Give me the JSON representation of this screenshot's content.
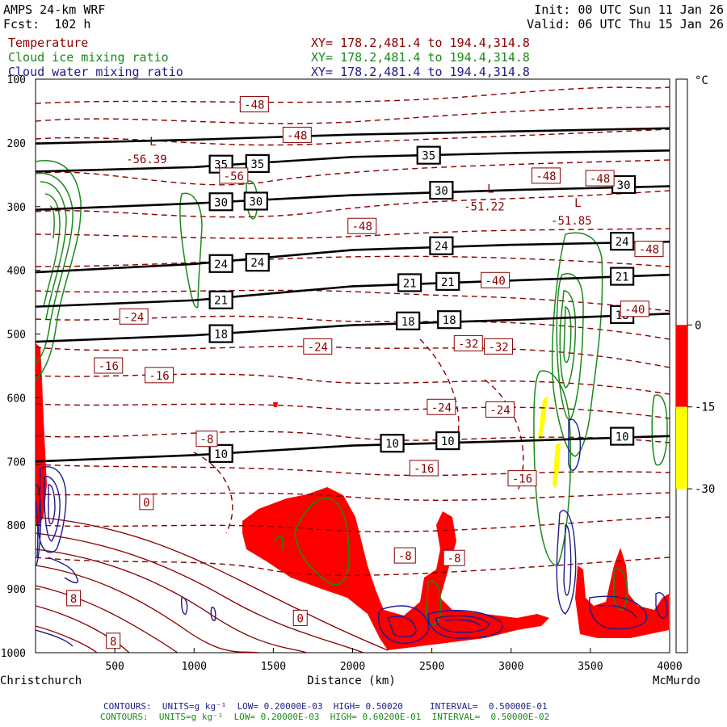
{
  "header": {
    "model": "AMPS 24-km WRF",
    "init_label": "Init:",
    "init_value": "00 UTC Sun 11 Jan 26",
    "fcst_label": "Fcst:",
    "fcst_value": "102 h",
    "valid_label": "Valid:",
    "valid_value": "06 UTC Thu 15 Jan 26",
    "fields": [
      {
        "name": "Temperature",
        "xy": "XY= 178.2,481.4 to 194.4,314.8"
      },
      {
        "name": "Cloud ice mixing ratio",
        "xy": "XY= 178.2,481.4 to 194.4,314.8"
      },
      {
        "name": "Cloud water mixing ratio",
        "xy": "XY= 178.2,481.4 to 194.4,314.8"
      }
    ]
  },
  "colors": {
    "temperature": "#8b0000",
    "cloud_ice": "#1a8a1a",
    "cloud_water": "#1c1c8c",
    "fill_red": "#ff0000",
    "fill_yellow": "#ffff00",
    "theta_lines": "#000000"
  },
  "chart_data": {
    "type": "line",
    "xlabel": "Distance (km)",
    "x_end_labels": {
      "left": "Christchurch",
      "right": "McMurdo"
    },
    "xlim": [
      0,
      4000
    ],
    "ylim": [
      1000,
      100
    ],
    "x_ticks": [
      500,
      1000,
      1500,
      2000,
      2500,
      3000,
      3500,
      4000
    ],
    "y_ticks": [
      100,
      200,
      300,
      400,
      500,
      600,
      700,
      800,
      900,
      1000
    ],
    "theta_lines": [
      {
        "label": "10",
        "points": [
          [
            0,
            700
          ],
          [
            1000,
            690
          ],
          [
            2000,
            675
          ],
          [
            3000,
            668
          ],
          [
            4000,
            660
          ]
        ],
        "label_at": [
          [
            1170,
            688
          ],
          [
            2250,
            672
          ],
          [
            2600,
            668
          ],
          [
            3700,
            661
          ]
        ]
      },
      {
        "label": "18",
        "points": [
          [
            0,
            512
          ],
          [
            1000,
            502
          ],
          [
            2000,
            486
          ],
          [
            3000,
            478
          ],
          [
            4000,
            468
          ]
        ],
        "label_at": [
          [
            1170,
            500
          ],
          [
            2350,
            480
          ],
          [
            2610,
            478
          ],
          [
            3700,
            470
          ]
        ]
      },
      {
        "label": "21",
        "points": [
          [
            0,
            457
          ],
          [
            1000,
            447
          ],
          [
            2000,
            425
          ],
          [
            3000,
            416
          ],
          [
            4000,
            407
          ]
        ],
        "label_at": [
          [
            1170,
            447
          ],
          [
            2360,
            420
          ],
          [
            2600,
            418
          ],
          [
            3700,
            410
          ]
        ]
      },
      {
        "label": "24",
        "points": [
          [
            0,
            403
          ],
          [
            1000,
            390
          ],
          [
            2000,
            368
          ],
          [
            3000,
            360
          ],
          [
            4000,
            355
          ]
        ],
        "label_at": [
          [
            1170,
            390
          ],
          [
            1400,
            388
          ],
          [
            2560,
            362
          ],
          [
            3700,
            355
          ]
        ]
      },
      {
        "label": "30",
        "points": [
          [
            0,
            305
          ],
          [
            1000,
            295
          ],
          [
            2000,
            282
          ],
          [
            3000,
            274
          ],
          [
            4000,
            268
          ]
        ],
        "label_at": [
          [
            1170,
            293
          ],
          [
            1390,
            292
          ],
          [
            2560,
            275
          ],
          [
            3710,
            266
          ]
        ]
      },
      {
        "label": "35",
        "points": [
          [
            0,
            245
          ],
          [
            1000,
            238
          ],
          [
            2000,
            222
          ],
          [
            3000,
            216
          ],
          [
            4000,
            212
          ]
        ],
        "label_at": [
          [
            1170,
            234
          ],
          [
            1400,
            233
          ],
          [
            2480,
            220
          ]
        ]
      },
      {
        "label": "",
        "points": [
          [
            0,
            201
          ],
          [
            1000,
            195
          ],
          [
            2000,
            187
          ],
          [
            3000,
            182
          ],
          [
            4000,
            177
          ]
        ],
        "label_at": []
      }
    ],
    "temperature_labels": [
      {
        "t": "-48",
        "x": 1380,
        "y": 140
      },
      {
        "t": "-48",
        "x": 1650,
        "y": 188
      },
      {
        "t": "-56",
        "x": 1250,
        "y": 252
      },
      {
        "t": "-48",
        "x": 3220,
        "y": 252
      },
      {
        "t": "-48",
        "x": 3560,
        "y": 256
      },
      {
        "t": "-48",
        "x": 2060,
        "y": 331
      },
      {
        "t": "-48",
        "x": 3870,
        "y": 367
      },
      {
        "t": "-40",
        "x": 2900,
        "y": 416
      },
      {
        "t": "-40",
        "x": 3780,
        "y": 461
      },
      {
        "t": "-24",
        "x": 620,
        "y": 473
      },
      {
        "t": "-32",
        "x": 2730,
        "y": 515
      },
      {
        "t": "-32",
        "x": 2920,
        "y": 520
      },
      {
        "t": "-24",
        "x": 1780,
        "y": 520
      },
      {
        "t": "-16",
        "x": 460,
        "y": 550
      },
      {
        "t": "-16",
        "x": 780,
        "y": 565
      },
      {
        "t": "-24",
        "x": 2560,
        "y": 615
      },
      {
        "t": "-24",
        "x": 2930,
        "y": 619
      },
      {
        "t": "-8",
        "x": 1080,
        "y": 665
      },
      {
        "t": "-16",
        "x": 2450,
        "y": 711
      },
      {
        "t": "-16",
        "x": 3070,
        "y": 727
      },
      {
        "t": "0",
        "x": 700,
        "y": 764
      },
      {
        "t": "-8",
        "x": 2330,
        "y": 848
      },
      {
        "t": "-8",
        "x": 2640,
        "y": 852
      },
      {
        "t": "8",
        "x": 240,
        "y": 915
      },
      {
        "t": "0",
        "x": 1670,
        "y": 946
      },
      {
        "t": "8",
        "x": 490,
        "y": 982
      }
    ],
    "extrema": [
      {
        "mark": "L",
        "value": "-56.39",
        "x": 700,
        "y": 232
      },
      {
        "mark": "L",
        "value": "-51.22",
        "x": 2830,
        "y": 306
      },
      {
        "mark": "L",
        "value": "-51.85",
        "x": 3380,
        "y": 328
      }
    ],
    "colorbar": {
      "unit": "°C",
      "boundaries": [
        {
          "label": "0",
          "value": 0
        },
        {
          "label": "-15",
          "value": -15
        },
        {
          "label": "-30",
          "value": -30
        }
      ],
      "bands": [
        {
          "from": 0,
          "to": -15,
          "color": "#ff0000"
        },
        {
          "from": -15,
          "to": -30,
          "color": "#ffff00"
        }
      ]
    }
  },
  "footer": {
    "line1": "CONTOURS:  UNITS=g kg⁻¹  LOW= 0.20000E-03  HIGH= 0.50020     INTERVAL=  0.50000E-01",
    "line2": "CONTOURS:  UNITS=g kg⁻¹  LOW= 0.20000E-03  HIGH= 0.60200E-01  INTERVAL=  0.50000E-02"
  }
}
